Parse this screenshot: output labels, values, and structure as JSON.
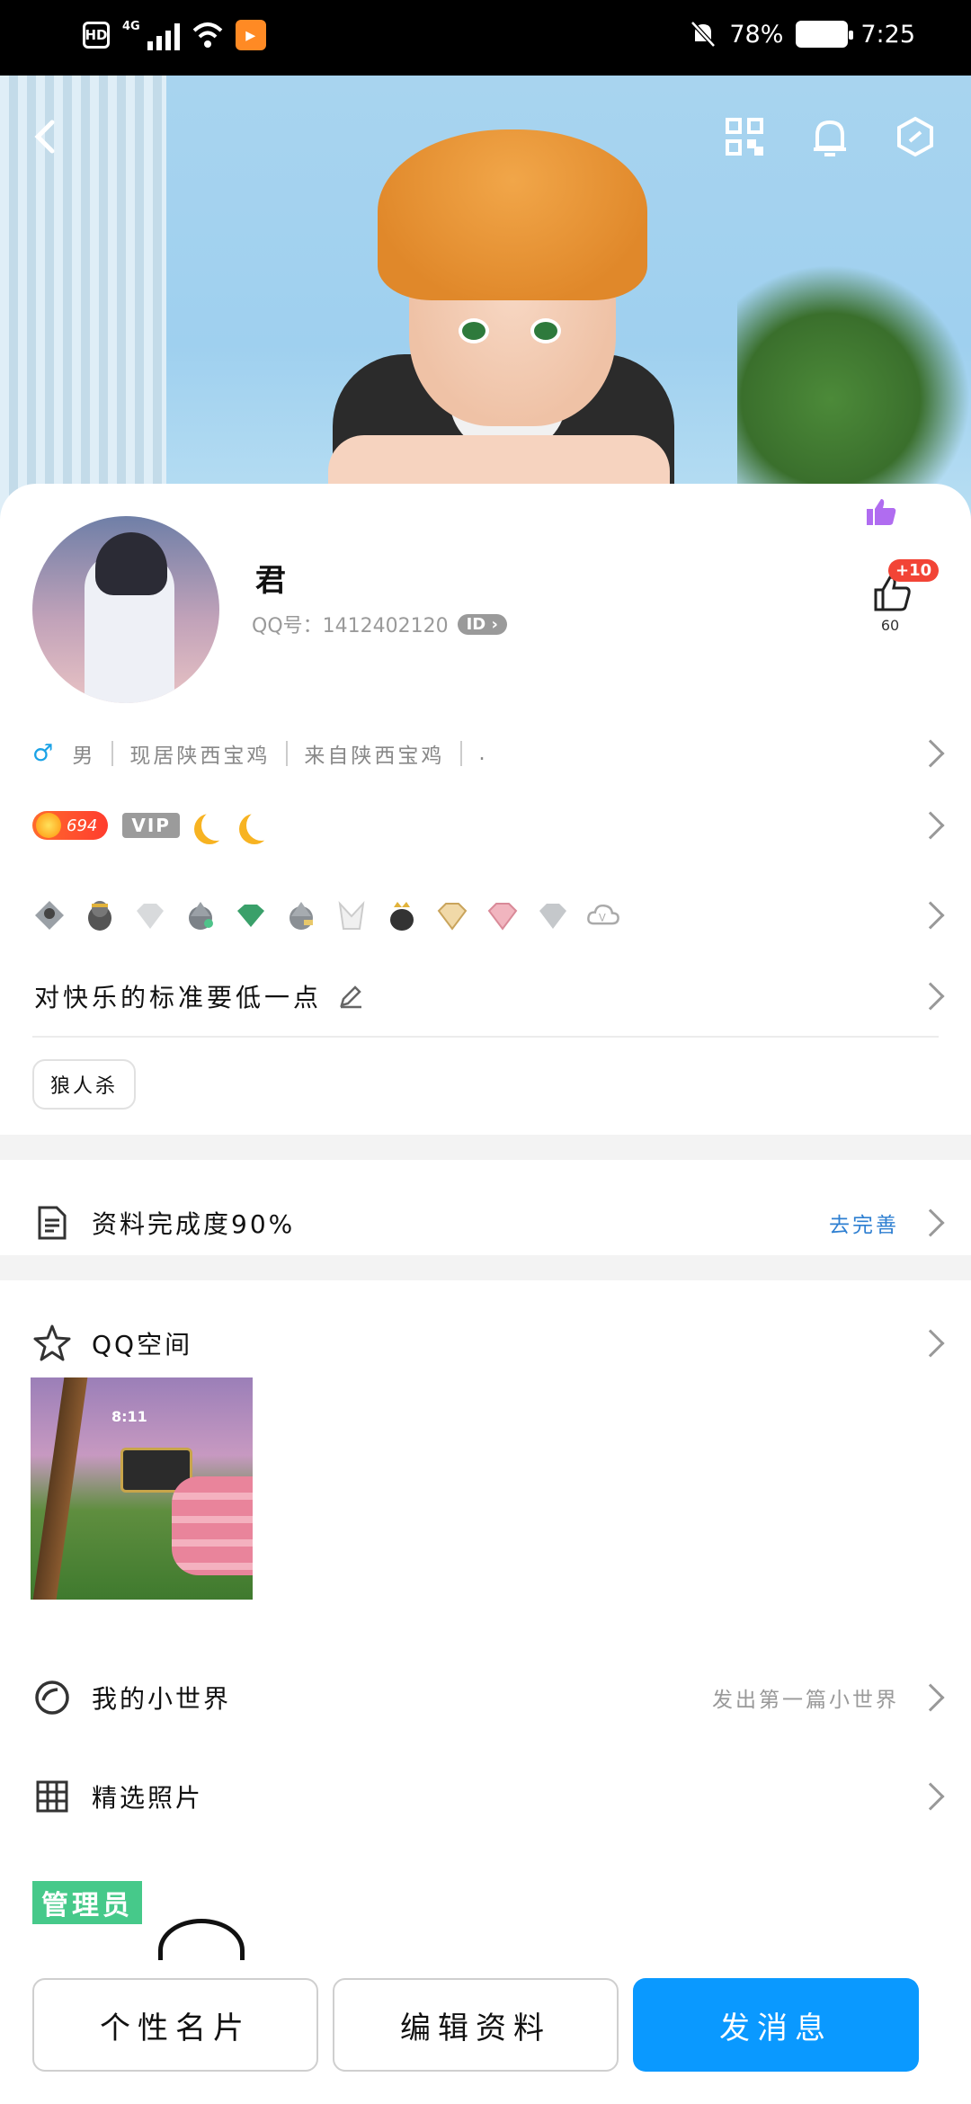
{
  "status_bar": {
    "hd": "HD",
    "network": "4G",
    "battery_percent": "78%",
    "time": "7:25"
  },
  "header": {
    "icons": [
      "back-icon",
      "qr-code-icon",
      "bell-icon",
      "settings-hex-icon"
    ]
  },
  "profile": {
    "nickname": "君",
    "qq_number": "QQ号：1412402120",
    "id_badge": "ID",
    "like_plus": "+10",
    "like_count": "60",
    "gender": "男",
    "location_now": "现居陕西宝鸡",
    "location_from": "来自陕西宝鸡",
    "extra": ".",
    "level": "694",
    "vip": "VIP",
    "signature": "对快乐的标准要低一点",
    "tag": "狼人杀"
  },
  "completion": {
    "label": "资料完成度90%",
    "action": "去完善"
  },
  "qzone": {
    "label": "QQ空间",
    "thumb_time": "8:11"
  },
  "small_world": {
    "label": "我的小世界",
    "hint": "发出第一篇小世界"
  },
  "photos": {
    "label": "精选照片",
    "thumb_text": "管理员"
  },
  "bottom": {
    "card_button": "个性名片",
    "edit_button": "编辑资料",
    "message_button": "发消息"
  },
  "colors": {
    "primary": "#0a99ff",
    "link_blue": "#2e7fd1",
    "like_badge": "#f24436",
    "level_orange": "#ff5a2d"
  }
}
